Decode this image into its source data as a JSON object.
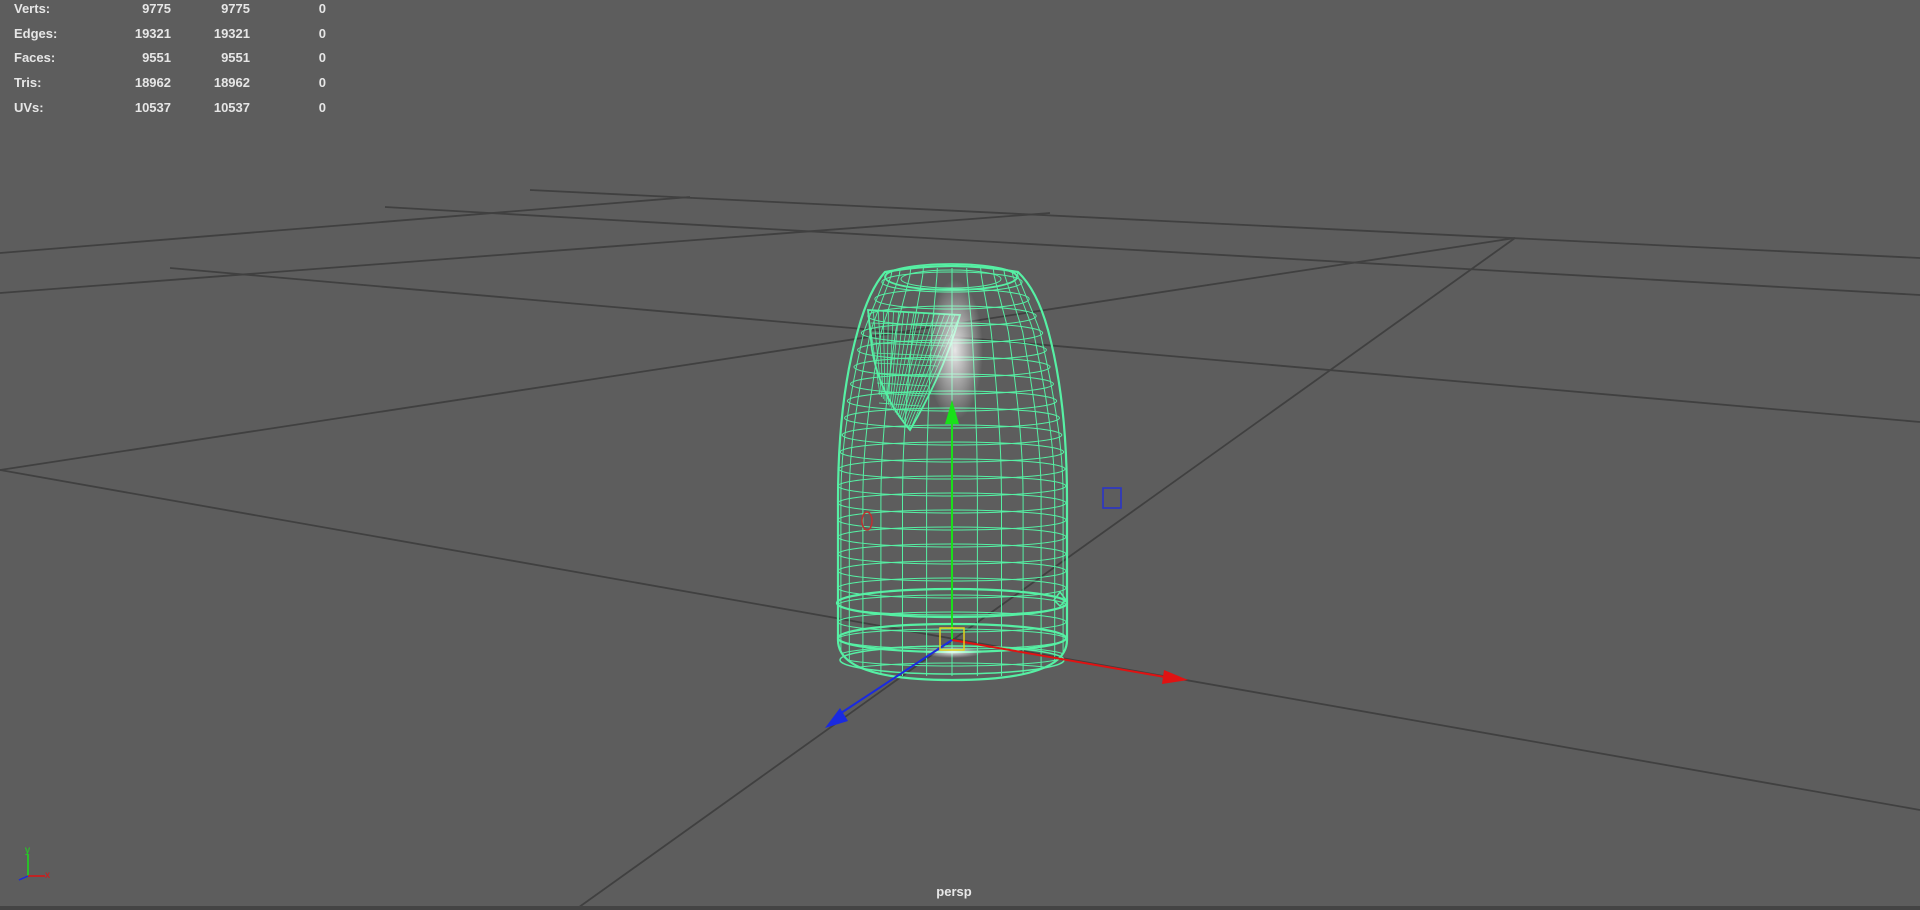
{
  "stats": {
    "rows": [
      {
        "label": "Verts:",
        "v1": "9775",
        "v2": "9775",
        "v3": "0"
      },
      {
        "label": "Edges:",
        "v1": "19321",
        "v2": "19321",
        "v3": "0"
      },
      {
        "label": "Faces:",
        "v1": "9551",
        "v2": "9551",
        "v3": "0"
      },
      {
        "label": "Tris:",
        "v1": "18962",
        "v2": "18962",
        "v3": "0"
      },
      {
        "label": "UVs:",
        "v1": "10537",
        "v2": "10537",
        "v3": "0"
      }
    ]
  },
  "camera": {
    "name": "persp"
  },
  "axis_indicator": {
    "y": "y",
    "x": "x"
  },
  "colors": {
    "background": "#5d5d5d",
    "grid": "#3f3f3f",
    "wireframe": "#56f0a4",
    "x_axis": "#e01212",
    "y_axis": "#19e019",
    "z_axis": "#1a2ae0",
    "pivot": "#e3d21b"
  },
  "icons": [
    "translate-manipulator-icon",
    "axis-indicator-icon",
    "scale-handle-icon"
  ]
}
